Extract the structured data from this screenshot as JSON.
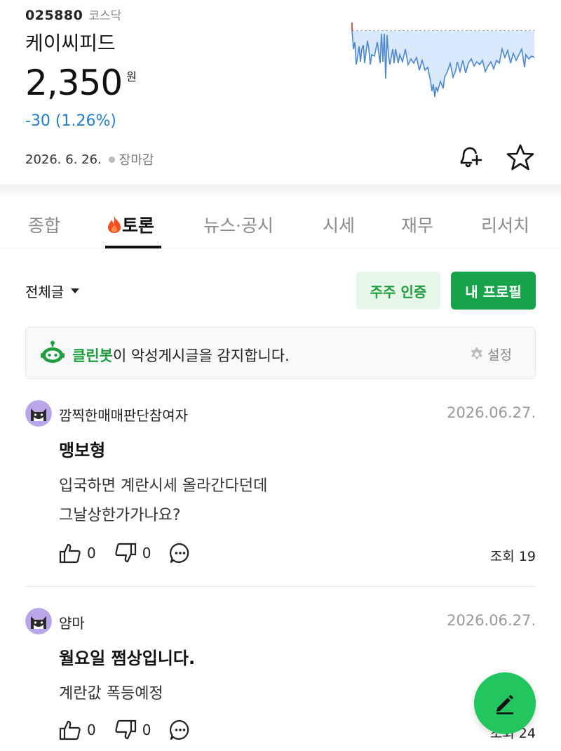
{
  "stock": {
    "code": "025880",
    "market": "코스닥",
    "name": "케이씨피드",
    "price": "2,350",
    "currency": "원",
    "change": "-30 (1.26%)",
    "date": "2026. 6. 26.",
    "status": "장마감"
  },
  "colors": {
    "down_blue": "#1e7fd6",
    "brand_green": "#16a34a",
    "light_green_bg": "#e6f7ea",
    "fab_green": "#22c55e"
  },
  "icons": {
    "bell": "bell-plus-icon",
    "star": "star-icon",
    "like": "thumbs-up-icon",
    "dislike": "thumbs-down-icon",
    "comment": "comment-dots-icon",
    "settings": "gear-icon",
    "write": "pencil-icon"
  },
  "tabs": [
    {
      "label": "종합"
    },
    {
      "label": "토론",
      "active": true
    },
    {
      "label": "뉴스·공시"
    },
    {
      "label": "시세"
    },
    {
      "label": "재무"
    },
    {
      "label": "리서치"
    }
  ],
  "filter": {
    "all_label": "전체글",
    "verify_label": "주주 인증",
    "profile_label": "내 프로필"
  },
  "banner": {
    "bot_name": "클린봇",
    "message": "이 악성게시글을 감지합니다.",
    "settings_label": "설정"
  },
  "posts": [
    {
      "author": "깜찍한매매판단참여자",
      "date": "2026.06.27.",
      "title": "맹보형",
      "body_lines": [
        "입국하면 계란시세 올라간다던데",
        "그날상한가가나요?"
      ],
      "likes": "0",
      "dislikes": "0",
      "views": "조회 19"
    },
    {
      "author": "얌마",
      "date": "2026.06.27.",
      "title": "월요일 쩜상입니다.",
      "body_lines": [
        "계란값 폭등예정"
      ],
      "likes": "0",
      "dislikes": "0",
      "views": "조회 24"
    }
  ]
}
